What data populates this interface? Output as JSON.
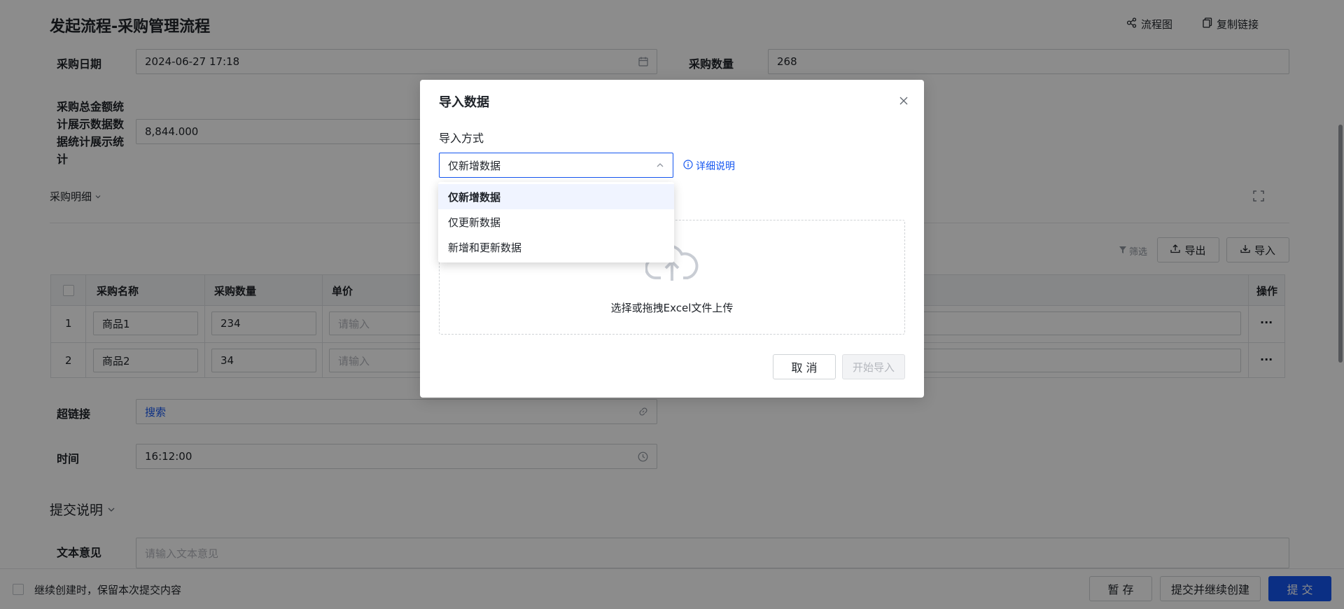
{
  "header": {
    "title": "发起流程-采购管理流程",
    "flow_chart": "流程图",
    "copy_link": "复制链接"
  },
  "form": {
    "purchase_date_label": "采购日期",
    "purchase_date_value": "2024-06-27 17:18",
    "purchase_qty_label": "采购数量",
    "purchase_qty_value": "268",
    "total_amount_label": "采购总金额统计展示数据数据统计展示统计",
    "total_amount_value": "8,844.000",
    "detail_section": "采购明细",
    "hyperlink_label": "超链接",
    "hyperlink_value": "搜索",
    "time_label": "时间",
    "time_value": "16:12:00",
    "submit_desc_section": "提交说明",
    "text_opinion_label": "文本意见",
    "text_opinion_placeholder": "请输入文本意见"
  },
  "table_toolbar": {
    "filter": "筛选",
    "export": "导出",
    "import": "导入"
  },
  "table": {
    "columns": [
      "采购名称",
      "采购数量",
      "单价",
      "操作"
    ],
    "rows": [
      {
        "index": "1",
        "name": "商品1",
        "qty": "234",
        "price_placeholder": "请输入",
        "more": "···"
      },
      {
        "index": "2",
        "name": "商品2",
        "qty": "34",
        "price_placeholder": "请输入",
        "more": "···"
      }
    ]
  },
  "footer": {
    "keep_content": "继续创建时，保留本次提交内容",
    "save_draft": "暂 存",
    "submit_continue": "提交并继续创建",
    "submit": "提 交"
  },
  "modal": {
    "title": "导入数据",
    "method_label": "导入方式",
    "selected": "仅新增数据",
    "detail_link": "详细说明",
    "options": [
      "仅新增数据",
      "仅更新数据",
      "新增和更新数据"
    ],
    "upload_text": "选择或拖拽Excel文件上传",
    "cancel": "取 消",
    "start": "开始导入"
  },
  "colors": {
    "primary": "#1456f0",
    "mask": "rgba(0,0,0,0.45)"
  }
}
